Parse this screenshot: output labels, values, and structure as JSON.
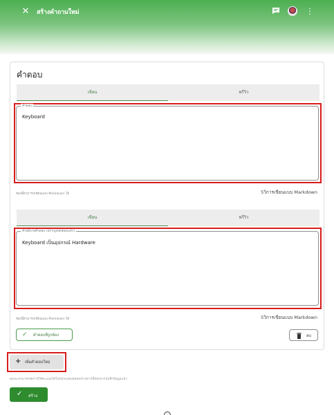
{
  "header": {
    "title": "สร้างคำถามใหม่",
    "close_icon": "close-icon",
    "chat_icon": "message-icon",
    "more_icon": "more-vert-icon"
  },
  "card": {
    "title": "คำตอบ",
    "answer_block_1": {
      "tabs": {
        "write": "เขียน",
        "preview": "พรีวิว"
      },
      "field_label": "คำตอบ",
      "field_value": "Keyboard",
      "hint_left": "ช่องนี้สามารถเขียนแบบ Markdown ได้",
      "hint_right": "5วิการเขียนแบบ Markdown"
    },
    "answer_block_2": {
      "tabs": {
        "write": "เขียน",
        "preview": "พรีวิว"
      },
      "field_label": "คำอธิบายคำตอบ (ปรากฏหลังตอบแล้ว)",
      "field_value": "Keyboard เป็นอุปกรณ์ Hardware",
      "hint_left": "ช่องนี้สามารถเขียนแบบ Markdown ได้",
      "hint_right": "5วิการเขียนแบบ Markdown"
    },
    "correct_button": "คำตอบที่ถูกต้อง",
    "delete_button": "ลบ"
  },
  "add_answer_button": "เพิ่มคำตอบใหม่",
  "note": "คุณจะสามารถจัดการให้คะแนนได้ในหน้าแสดงผลของรายการนี้หลังจากบันทึกข้อมูลแล้ว",
  "create_button": "สร้าง",
  "colors": {
    "accent": "#2e8b2e",
    "highlight": "#d81b1b",
    "header_top": "#4caf50"
  }
}
